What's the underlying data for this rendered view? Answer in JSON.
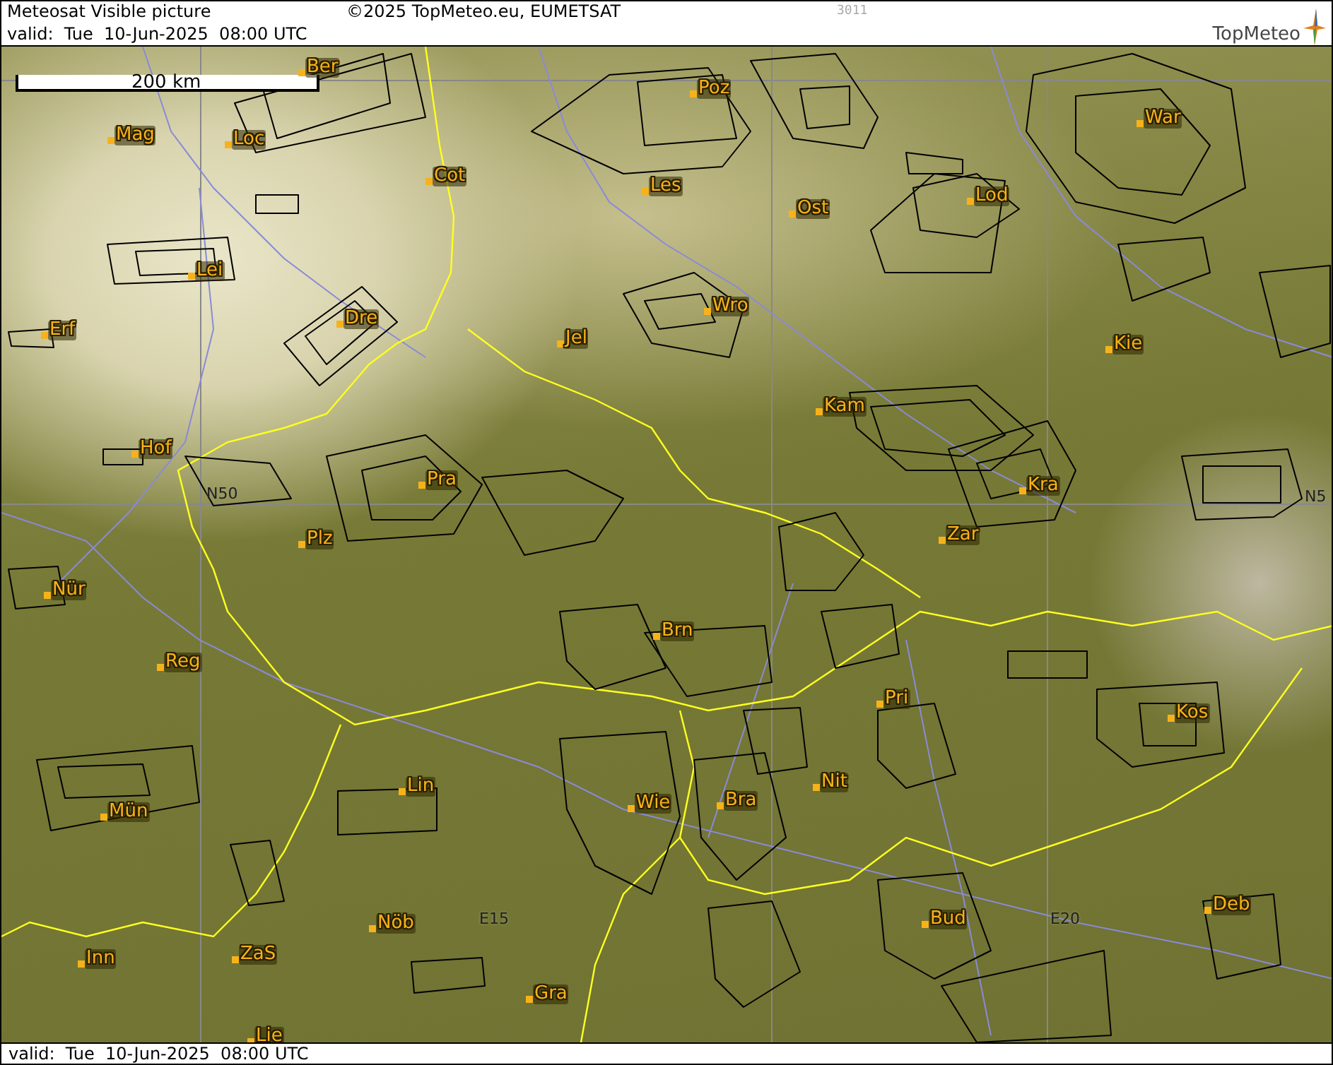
{
  "header": {
    "title": "Meteosat Visible picture",
    "copyright": "©2025 TopMeteo.eu, EUMETSAT",
    "code": "3011",
    "valid": "valid:  Tue  10-Jun-2025  08:00 UTC",
    "logo": "TopMeteo"
  },
  "map": {
    "scale": "200 km",
    "grid_labels": [
      "N50",
      "N5",
      "E15",
      "E20"
    ],
    "cities": [
      {
        "name": "Ber"
      },
      {
        "name": "Mag"
      },
      {
        "name": "Loc"
      },
      {
        "name": "Cot"
      },
      {
        "name": "Poz"
      },
      {
        "name": "Les"
      },
      {
        "name": "Ost"
      },
      {
        "name": "Lod"
      },
      {
        "name": "War"
      },
      {
        "name": "Lei"
      },
      {
        "name": "Dre"
      },
      {
        "name": "Erf"
      },
      {
        "name": "Jel"
      },
      {
        "name": "Wro"
      },
      {
        "name": "Kie"
      },
      {
        "name": "Kam"
      },
      {
        "name": "Hof"
      },
      {
        "name": "Pra"
      },
      {
        "name": "Kra"
      },
      {
        "name": "Plz"
      },
      {
        "name": "Zar"
      },
      {
        "name": "Nür"
      },
      {
        "name": "Brn"
      },
      {
        "name": "Reg"
      },
      {
        "name": "Pri"
      },
      {
        "name": "Kos"
      },
      {
        "name": "Lin"
      },
      {
        "name": "Nit"
      },
      {
        "name": "Wie"
      },
      {
        "name": "Bra"
      },
      {
        "name": "Mün"
      },
      {
        "name": "Deb"
      },
      {
        "name": "Nöb"
      },
      {
        "name": "Bud"
      },
      {
        "name": "Inn"
      },
      {
        "name": "ZaS"
      },
      {
        "name": "Gra"
      },
      {
        "name": "Lie"
      }
    ]
  },
  "footer": {
    "valid": "valid:  Tue  10-Jun-2025  08:00 UTC"
  }
}
